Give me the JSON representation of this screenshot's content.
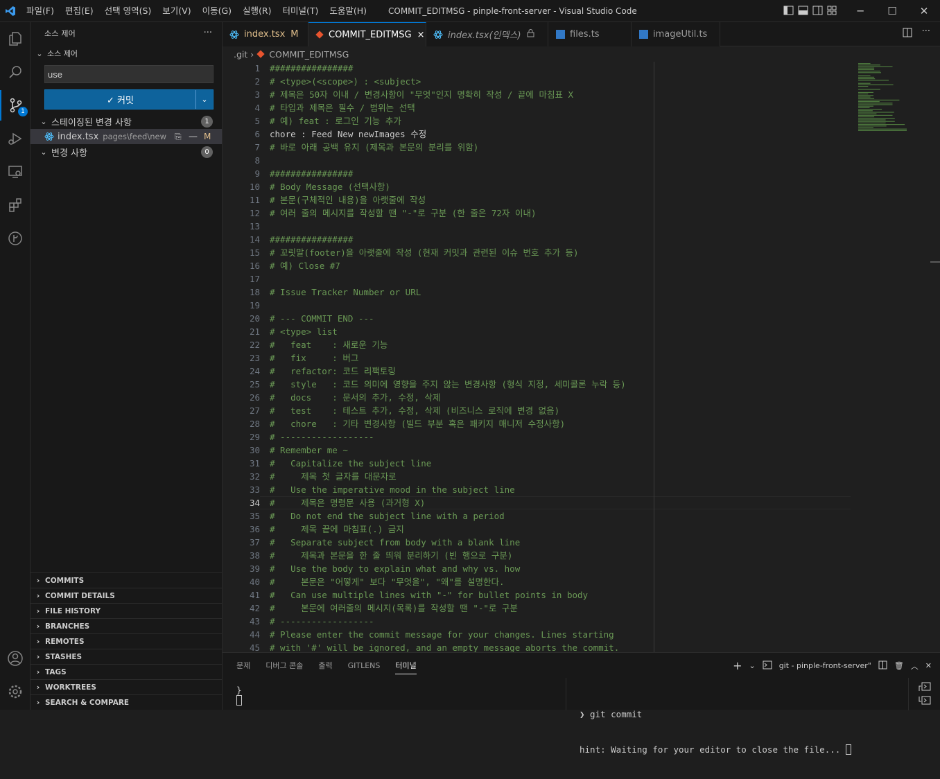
{
  "window": {
    "title": "COMMIT_EDITMSG - pinple-front-server - Visual Studio Code"
  },
  "menu": [
    "파일(F)",
    "편집(E)",
    "선택 영역(S)",
    "보기(V)",
    "이동(G)",
    "실행(R)",
    "터미널(T)",
    "도움말(H)"
  ],
  "activity": {
    "scm_badge": "1"
  },
  "sidebar": {
    "title": "소스 제어",
    "section": "소스 제어",
    "commit_input_value": "use",
    "commit_button": "✓ 커밋",
    "staged_label": "스테이징된 변경 사항",
    "staged_count": "1",
    "staged_file": {
      "name": "index.tsx",
      "path": "pages\\feed\\new",
      "status": "M"
    },
    "changes_label": "변경 사항",
    "changes_count": "0",
    "bottom_sections": [
      "COMMITS",
      "COMMIT DETAILS",
      "FILE HISTORY",
      "BRANCHES",
      "REMOTES",
      "STASHES",
      "TAGS",
      "WORKTREES",
      "SEARCH & COMPARE"
    ]
  },
  "tabs": [
    {
      "label": "index.tsx",
      "suffix": "M",
      "icon": "react-icon"
    },
    {
      "label": "COMMIT_EDITMSG",
      "suffix": "×",
      "icon": "git-icon"
    },
    {
      "label": "index.tsx(인덱스)",
      "suffix": "",
      "icon": "react-icon"
    },
    {
      "label": "files.ts",
      "suffix": "",
      "icon": "ts-icon"
    },
    {
      "label": "imageUtil.ts",
      "suffix": "",
      "icon": "ts-icon"
    }
  ],
  "breadcrumb": {
    "folder": ".git",
    "file": "COMMIT_EDITMSG"
  },
  "editor": {
    "current_line": 34,
    "lines": [
      "################",
      "# <type>(<scope>) : <subject>",
      "# 제목은 50자 이내 / 변경사항이 \"무엇\"인지 명확히 작성 / 끝에 마침표 X",
      "# 타입과 제목은 필수 / 범위는 선택",
      "# 예) feat : 로그인 기능 추가",
      "chore : Feed New newImages 수정",
      "# 바로 아래 공백 유지 (제목과 본문의 분리를 위함)",
      "",
      "################",
      "# Body Message (선택사항)",
      "# 본문(구체적인 내용)을 아랫줄에 작성",
      "# 여러 줄의 메시지를 작성할 땐 \"-\"로 구분 (한 줄은 72자 이내)",
      "",
      "################",
      "# 꼬릿말(footer)을 아랫줄에 작성 (현재 커밋과 관련된 이슈 번호 추가 등)",
      "# 예) Close #7",
      "",
      "# Issue Tracker Number or URL",
      "",
      "# --- COMMIT END ---",
      "# <type> list",
      "#   feat    : 새로운 기능",
      "#   fix     : 버그",
      "#   refactor: 코드 리팩토링",
      "#   style   : 코드 의미에 영향을 주지 않는 변경사항 (형식 지정, 세미콜론 누락 등)",
      "#   docs    : 문서의 추가, 수정, 삭제",
      "#   test    : 테스트 추가, 수정, 삭제 (비즈니스 로직에 변경 없음)",
      "#   chore   : 기타 변경사항 (빌드 부분 혹은 패키지 매니저 수정사항)",
      "# ------------------",
      "# Remember me ~",
      "#   Capitalize the subject line",
      "#     제목 첫 글자를 대문자로",
      "#   Use the imperative mood in the subject line",
      "#     제목은 명령문 사용 (과거형 X)",
      "#   Do not end the subject line with a period",
      "#     제목 끝에 마침표(.) 금지",
      "#   Separate subject from body with a blank line",
      "#     제목과 본문을 한 줄 띄워 분리하기 (빈 행으로 구분)",
      "#   Use the body to explain what and why vs. how",
      "#     본문은 \"어떻게\" 보다 \"무엇을\", \"왜\"를 설명한다.",
      "#   Can use multiple lines with \"-\" for bullet points in body",
      "#     본문에 여러줄의 메시지(목록)를 작성할 땐 \"-\"로 구분",
      "# ------------------",
      "# Please enter the commit message for your changes. Lines starting",
      "# with '#' will be ignored, and an empty message aborts the commit."
    ]
  },
  "panel": {
    "tabs": [
      "문제",
      "디버그 콘솔",
      "출력",
      "GITLENS",
      "터미널"
    ],
    "active_tab": "터미널",
    "terminal_name": "git - pinple-front-server\"",
    "left_terminal": "}",
    "right_prompt": "❯ git commit",
    "right_hint": "hint: Waiting for your editor to close the file... "
  },
  "colors": {
    "accent": "#0078d4",
    "comment": "#6a9955",
    "button": "#0e639c"
  }
}
